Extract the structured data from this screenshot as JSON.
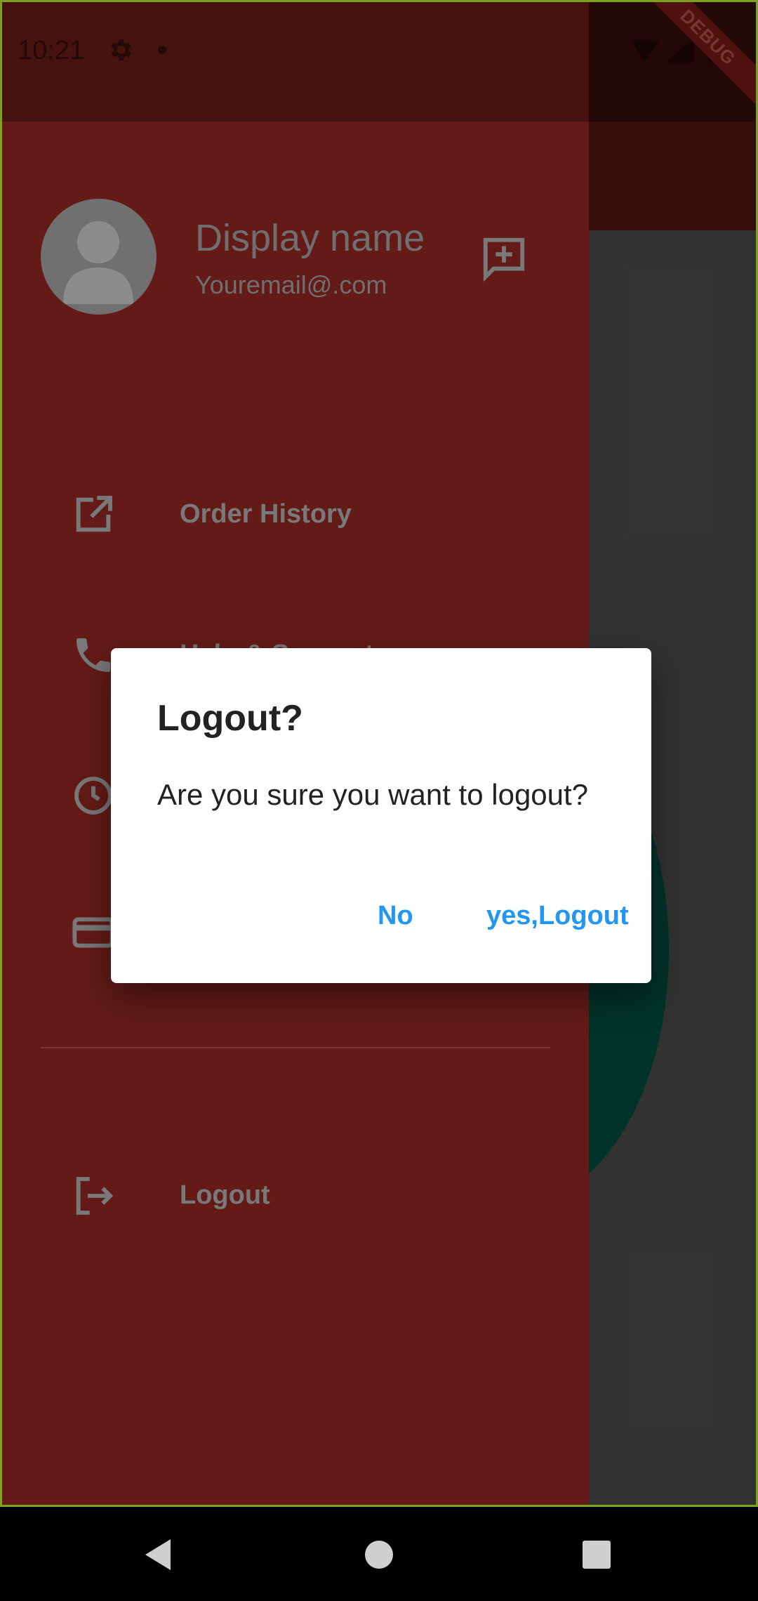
{
  "status_bar": {
    "time": "10:21",
    "debug_label": "DEBUG"
  },
  "drawer": {
    "display_name": "Display name",
    "email": "Youremail@.com",
    "menu": [
      {
        "label": "Order History",
        "icon": "open-in-new-icon"
      },
      {
        "label": "Help & Support",
        "icon": "phone-icon"
      },
      {
        "label": "",
        "icon": "history-icon"
      },
      {
        "label": "",
        "icon": "credit-card-icon"
      }
    ],
    "logout_label": "Logout"
  },
  "dialog": {
    "title": "Logout?",
    "message": "Are you sure you want to logout?",
    "no_label": "No",
    "yes_label": "yes,Logout"
  },
  "colors": {
    "drawer_bg": "#721f1b",
    "dialog_button": "#2196f3",
    "scrim_page": "#3a3a3a"
  }
}
